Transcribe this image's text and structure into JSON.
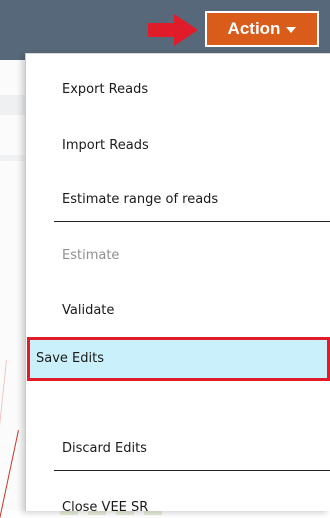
{
  "header": {
    "action_button": {
      "label": "Action",
      "color": "#d95c1a"
    },
    "annotation_arrow_color": "#e01b2a"
  },
  "menu": {
    "items": [
      {
        "label": "Export Reads",
        "enabled": true
      },
      {
        "label": "Import Reads",
        "enabled": true
      },
      {
        "label": "Estimate range of reads",
        "enabled": true
      },
      {
        "label": "Estimate",
        "enabled": false
      },
      {
        "label": "Validate",
        "enabled": true
      },
      {
        "label": "Save Edits",
        "enabled": true,
        "highlighted": true
      },
      {
        "label": "Discard Edits",
        "enabled": true
      },
      {
        "label": "Close VEE SR",
        "enabled": true
      }
    ],
    "highlight_color": "#c9f0fb",
    "highlight_border_color": "#e01b2a"
  }
}
